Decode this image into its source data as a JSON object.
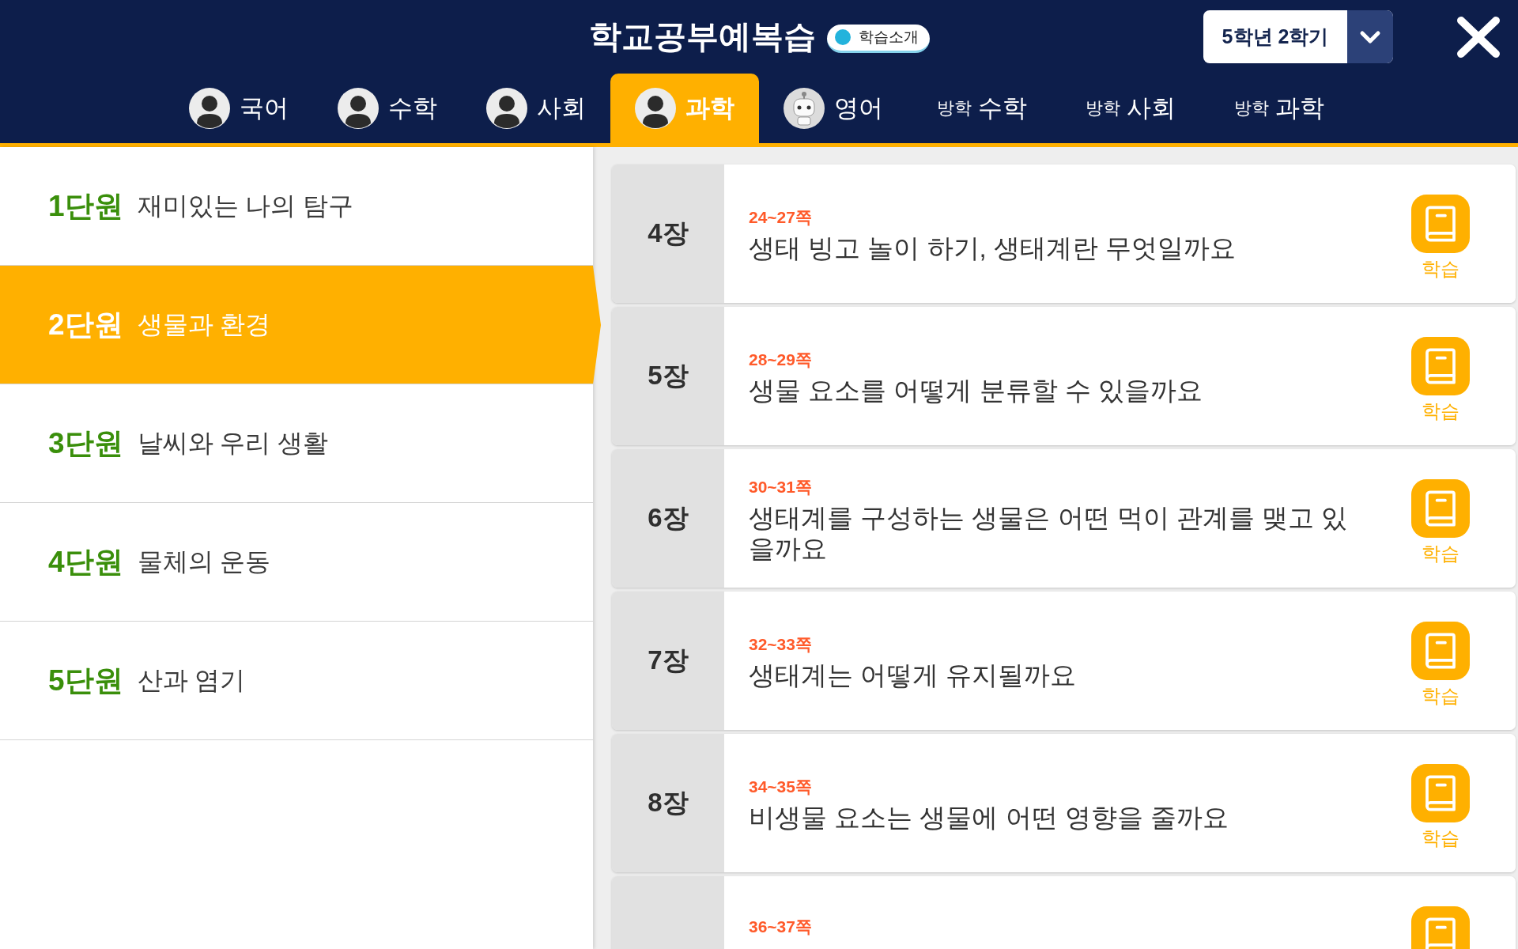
{
  "header": {
    "title": "학교공부예복습",
    "intro_badge": "학습소개",
    "grade_select": {
      "value": "5학년 2학기"
    }
  },
  "tabs": [
    {
      "label": "국어",
      "kind": "avatar",
      "selected": false
    },
    {
      "label": "수학",
      "kind": "avatar",
      "selected": false
    },
    {
      "label": "사회",
      "kind": "avatar",
      "selected": false
    },
    {
      "label": "과학",
      "kind": "avatar",
      "selected": true
    },
    {
      "label": "영어",
      "kind": "robot",
      "selected": false
    },
    {
      "prefix": "방학",
      "label": "수학",
      "kind": "vacation",
      "selected": false
    },
    {
      "prefix": "방학",
      "label": "사회",
      "kind": "vacation",
      "selected": false
    },
    {
      "prefix": "방학",
      "label": "과학",
      "kind": "vacation",
      "selected": false
    }
  ],
  "units": [
    {
      "number": "1단원",
      "title": "재미있는 나의 탐구",
      "selected": false
    },
    {
      "number": "2단원",
      "title": "생물과 환경",
      "selected": true
    },
    {
      "number": "3단원",
      "title": "날씨와 우리 생활",
      "selected": false
    },
    {
      "number": "4단원",
      "title": "물체의 운동",
      "selected": false
    },
    {
      "number": "5단원",
      "title": "산과 염기",
      "selected": false
    }
  ],
  "lessons": [
    {
      "chapter": "4장",
      "pages": "24~27쪽",
      "title": "생태 빙고 놀이 하기, 생태계란 무엇일까요",
      "button": "학습"
    },
    {
      "chapter": "5장",
      "pages": "28~29쪽",
      "title": "생물 요소를 어떻게 분류할 수 있을까요",
      "button": "학습"
    },
    {
      "chapter": "6장",
      "pages": "30~31쪽",
      "title": "생태계를 구성하는 생물은 어떤 먹이 관계를 맺고 있을까요",
      "button": "학습"
    },
    {
      "chapter": "7장",
      "pages": "32~33쪽",
      "title": "생태계는 어떻게 유지될까요",
      "button": "학습"
    },
    {
      "chapter": "8장",
      "pages": "34~35쪽",
      "title": "비생물 요소는 생물에 어떤 영향을 줄까요",
      "button": "학습"
    },
    {
      "pages": "36~37쪽"
    }
  ]
}
